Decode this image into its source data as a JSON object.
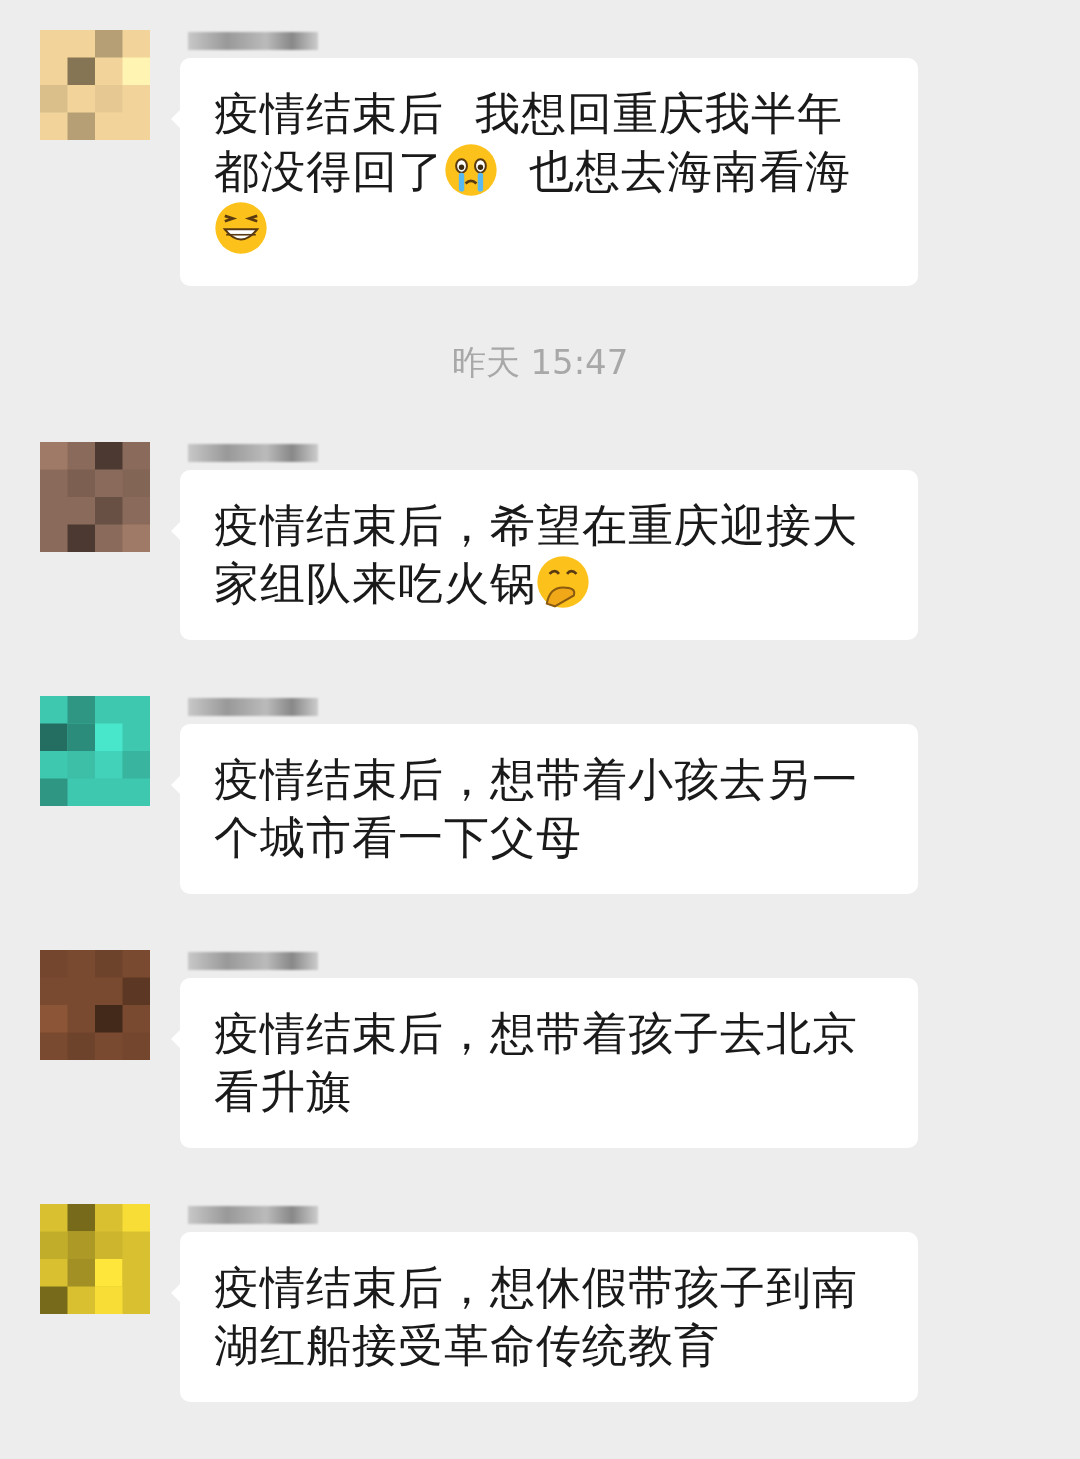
{
  "messages": [
    {
      "avatar": {
        "kind": "picture",
        "color": "#f2d49a"
      },
      "lines": [
        [
          {
            "kind": "text",
            "text": "疫情结束后  我想回重庆我半年"
          }
        ],
        [
          {
            "kind": "text",
            "text": "都没得回了"
          },
          {
            "kind": "crying-face"
          },
          {
            "kind": "text",
            "text": "  也想去海南看海"
          }
        ],
        [
          {
            "kind": "grin-face"
          }
        ]
      ]
    },
    {
      "kind": "time",
      "text": "昨天 15:47"
    },
    {
      "avatar": {
        "kind": "picture",
        "color": "#8a6a5a"
      },
      "lines": [
        [
          {
            "kind": "text",
            "text": "疫情结束后，希望在重庆迎接大"
          }
        ],
        [
          {
            "kind": "text",
            "text": "家组队来吃火锅"
          },
          {
            "kind": "hand-face"
          }
        ]
      ]
    },
    {
      "avatar": {
        "kind": "picture",
        "color": "#3fc8b0"
      },
      "lines": [
        [
          {
            "kind": "text",
            "text": "疫情结束后，想带着小孩去另一"
          }
        ],
        [
          {
            "kind": "text",
            "text": "个城市看一下父母"
          }
        ]
      ]
    },
    {
      "avatar": {
        "kind": "picture",
        "color": "#7a4a30"
      },
      "lines": [
        [
          {
            "kind": "text",
            "text": "疫情结束后，想带着孩子去北京"
          }
        ],
        [
          {
            "kind": "text",
            "text": "看升旗"
          }
        ]
      ]
    },
    {
      "avatar": {
        "kind": "picture",
        "color": "#d8c030"
      },
      "lines": [
        [
          {
            "kind": "text",
            "text": "疫情结束后，想休假带孩子到南"
          }
        ],
        [
          {
            "kind": "text",
            "text": "湖红船接受革命传统教育"
          }
        ]
      ]
    }
  ]
}
